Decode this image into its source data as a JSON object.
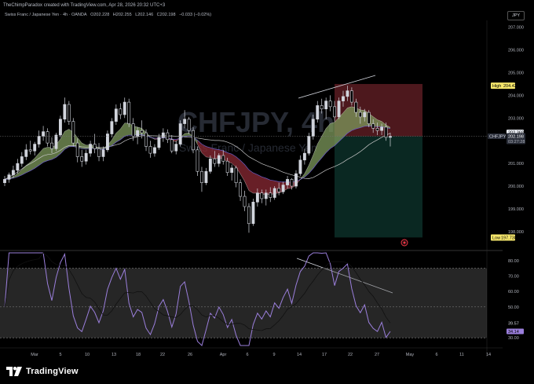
{
  "header": {
    "attribution": "TheChimpParadox created with TradingView.com, Apr 28, 2026 20:32 UTC+3",
    "symbol_desc": "Swiss Franc / Japanese Yen · 4h · OANDA",
    "open": "O202.228",
    "high": "H202.255",
    "low": "L202.146",
    "close": "C202.198",
    "change": "−0.033 (−0.02%)",
    "currency": "JPY"
  },
  "watermark": {
    "symbol": "CHFJPY, 4h",
    "desc": "Swiss Franc / Japanese Yen"
  },
  "price_axis": {
    "ticks": [
      "207.000",
      "206.000",
      "205.000",
      "204.000",
      "203.000",
      "201.000",
      "200.000",
      "199.000",
      "198.000"
    ],
    "labels": {
      "high_label": "High",
      "high_value": "204.426",
      "ma_value": "202.368",
      "symbol_tag": "CHFJPY",
      "current_price": "202.198",
      "countdown": "03:27:28",
      "low_label": "Low",
      "low_value": "197.738"
    }
  },
  "rsi_axis": {
    "ticks": [
      "80.00",
      "70.00",
      "60.00",
      "50.00",
      "40.00",
      "30.00"
    ],
    "labels": {
      "rsi_ma": "39.57",
      "rsi_value": "34.14"
    }
  },
  "time_axis": [
    "Mar",
    "5",
    "10",
    "13",
    "18",
    "22",
    "26",
    "Apr",
    "6",
    "9",
    "14",
    "17",
    "22",
    "27",
    "May",
    "6",
    "11",
    "14"
  ],
  "footer": {
    "brand": "TradingView"
  },
  "colors": {
    "bull": "#d1d4dc",
    "bear": "#d1d4dc",
    "cloud_up": "#7e9a5c",
    "cloud_down": "#8b2a34",
    "rsi": "#9b7fdc",
    "stop_zone": "#5a1c22",
    "target_zone": "#0b2a24",
    "badge_yellow": "#f5e66b"
  },
  "chart_data": {
    "type": "candlestick",
    "timeframe": "4h",
    "ylim": [
      197.2,
      207.3
    ],
    "yticks": [
      207,
      206,
      205,
      204,
      203,
      201,
      200,
      199,
      198
    ],
    "key_levels": {
      "high": 204.426,
      "low": 197.738,
      "current": 202.198,
      "ma": 202.368
    },
    "position": {
      "entry": 202.198,
      "stop": 204.5,
      "target": 197.74
    },
    "candles": [
      [
        200.15,
        200.45,
        200.0,
        200.3
      ],
      [
        200.3,
        200.6,
        200.15,
        200.5
      ],
      [
        200.5,
        200.9,
        200.35,
        200.7
      ],
      [
        200.7,
        201.2,
        200.55,
        201.0
      ],
      [
        201.0,
        201.5,
        200.85,
        201.3
      ],
      [
        201.3,
        201.85,
        201.15,
        201.6
      ],
      [
        201.6,
        202.0,
        201.4,
        201.55
      ],
      [
        201.55,
        201.95,
        201.35,
        201.85
      ],
      [
        201.85,
        202.45,
        201.7,
        202.2
      ],
      [
        202.2,
        202.65,
        202.0,
        202.4
      ],
      [
        202.4,
        202.55,
        201.75,
        201.9
      ],
      [
        201.9,
        202.15,
        201.45,
        201.65
      ],
      [
        201.65,
        202.35,
        201.55,
        202.25
      ],
      [
        202.25,
        203.1,
        202.15,
        202.95
      ],
      [
        202.95,
        203.9,
        202.8,
        203.6
      ],
      [
        203.6,
        203.75,
        202.7,
        202.85
      ],
      [
        202.85,
        203.0,
        201.75,
        201.9
      ],
      [
        201.9,
        202.1,
        201.05,
        201.3
      ],
      [
        201.3,
        201.6,
        200.85,
        201.1
      ],
      [
        201.1,
        201.6,
        200.95,
        201.45
      ],
      [
        201.45,
        202.0,
        201.3,
        201.85
      ],
      [
        201.85,
        202.3,
        201.45,
        201.65
      ],
      [
        201.65,
        201.9,
        201.1,
        201.3
      ],
      [
        201.3,
        201.75,
        201.1,
        201.6
      ],
      [
        201.6,
        202.45,
        201.5,
        202.3
      ],
      [
        202.3,
        203.0,
        202.15,
        202.85
      ],
      [
        202.85,
        203.6,
        202.7,
        203.4
      ],
      [
        203.4,
        203.65,
        202.95,
        203.15
      ],
      [
        203.15,
        203.9,
        203.0,
        203.7
      ],
      [
        203.7,
        203.85,
        202.6,
        202.75
      ],
      [
        202.75,
        203.0,
        202.0,
        202.2
      ],
      [
        202.2,
        202.6,
        201.85,
        202.45
      ],
      [
        202.45,
        202.9,
        202.1,
        202.35
      ],
      [
        202.35,
        202.5,
        201.55,
        201.75
      ],
      [
        201.75,
        202.0,
        201.25,
        201.45
      ],
      [
        201.45,
        201.85,
        201.3,
        201.7
      ],
      [
        201.7,
        202.3,
        201.6,
        202.15
      ],
      [
        202.15,
        202.55,
        201.95,
        202.35
      ],
      [
        202.35,
        202.5,
        201.9,
        202.05
      ],
      [
        202.05,
        202.25,
        201.45,
        201.55
      ],
      [
        201.55,
        202.0,
        201.4,
        201.85
      ],
      [
        201.85,
        202.9,
        201.75,
        202.75
      ],
      [
        202.75,
        203.35,
        202.55,
        202.95
      ],
      [
        202.95,
        203.05,
        202.3,
        202.45
      ],
      [
        202.45,
        202.6,
        201.45,
        201.6
      ],
      [
        201.6,
        201.75,
        200.45,
        200.65
      ],
      [
        200.65,
        200.85,
        199.75,
        200.15
      ],
      [
        200.15,
        200.8,
        200.05,
        200.65
      ],
      [
        200.65,
        201.35,
        200.55,
        201.2
      ],
      [
        201.2,
        201.55,
        200.85,
        201.0
      ],
      [
        201.0,
        201.45,
        200.85,
        201.35
      ],
      [
        201.35,
        201.6,
        200.95,
        201.1
      ],
      [
        201.1,
        201.25,
        200.45,
        200.6
      ],
      [
        200.6,
        200.95,
        200.25,
        200.8
      ],
      [
        200.8,
        200.9,
        199.95,
        200.15
      ],
      [
        200.15,
        200.3,
        199.35,
        199.55
      ],
      [
        199.55,
        199.8,
        198.9,
        199.1
      ],
      [
        199.1,
        199.25,
        197.95,
        198.35
      ],
      [
        198.35,
        199.45,
        198.25,
        199.3
      ],
      [
        199.3,
        199.9,
        199.1,
        199.7
      ],
      [
        199.7,
        199.85,
        199.25,
        199.45
      ],
      [
        199.45,
        199.85,
        199.15,
        199.7
      ],
      [
        199.7,
        199.95,
        199.3,
        199.5
      ],
      [
        199.5,
        200.0,
        199.4,
        199.9
      ],
      [
        199.9,
        200.15,
        199.6,
        199.75
      ],
      [
        199.75,
        200.2,
        199.65,
        200.05
      ],
      [
        200.05,
        200.45,
        199.9,
        200.3
      ],
      [
        200.3,
        200.35,
        199.85,
        200.0
      ],
      [
        200.0,
        200.7,
        199.9,
        200.55
      ],
      [
        200.55,
        201.35,
        200.45,
        201.15
      ],
      [
        201.15,
        201.65,
        200.95,
        201.45
      ],
      [
        201.45,
        202.35,
        201.35,
        202.2
      ],
      [
        202.2,
        203.15,
        202.05,
        202.95
      ],
      [
        202.95,
        203.75,
        202.8,
        203.55
      ],
      [
        203.55,
        203.85,
        203.2,
        203.4
      ],
      [
        203.4,
        203.9,
        202.95,
        203.75
      ],
      [
        203.75,
        204.0,
        203.3,
        203.5
      ],
      [
        203.5,
        203.75,
        202.85,
        203.05
      ],
      [
        203.05,
        203.9,
        202.95,
        203.75
      ],
      [
        203.75,
        204.2,
        203.5,
        203.95
      ],
      [
        203.95,
        204.426,
        203.75,
        204.2
      ],
      [
        204.2,
        204.35,
        203.55,
        203.7
      ],
      [
        203.7,
        203.85,
        203.05,
        203.25
      ],
      [
        203.25,
        203.5,
        202.75,
        203.05
      ],
      [
        203.05,
        203.4,
        202.85,
        203.25
      ],
      [
        203.25,
        203.35,
        202.6,
        202.75
      ],
      [
        202.75,
        202.95,
        202.35,
        202.55
      ],
      [
        202.55,
        202.8,
        202.25,
        202.45
      ],
      [
        202.45,
        202.75,
        202.25,
        202.6
      ],
      [
        202.6,
        202.8,
        202.0,
        202.15
      ],
      [
        202.15,
        202.35,
        201.75,
        202.198
      ]
    ],
    "rsi": {
      "ylim": [
        25,
        85
      ],
      "yticks": [
        80,
        70,
        60,
        50,
        40,
        30
      ],
      "band": [
        30,
        75
      ],
      "last": 34.14,
      "ma_last": 39.57
    }
  }
}
